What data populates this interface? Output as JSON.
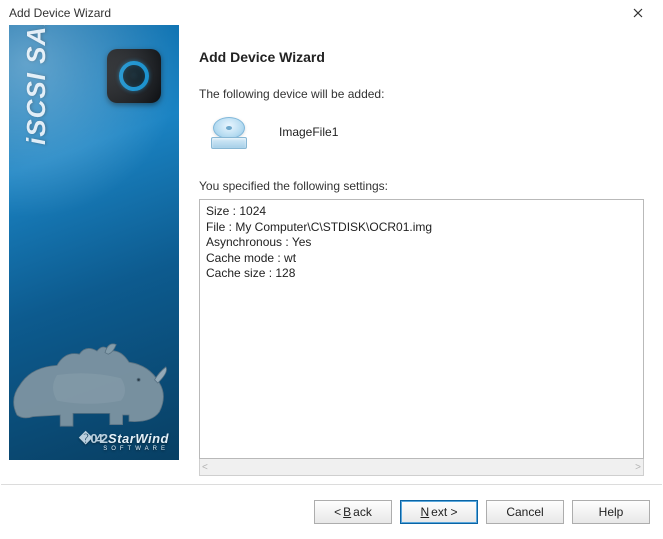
{
  "window": {
    "title": "Add Device Wizard"
  },
  "sidebar": {
    "vertical_label": "iSCSI SAN",
    "logo_text": "StarWind",
    "logo_sub": "SOFTWARE"
  },
  "main": {
    "heading": "Add Device Wizard",
    "intro": "The following device will be added:",
    "device_name": "ImageFile1",
    "settings_label": "You specified the following settings:",
    "settings": {
      "Size": "1024",
      "File": "My Computer\\C\\STDISK\\OCR01.img",
      "Asynchronous": "Yes",
      "Cache mode": "wt",
      "Cache size": "128"
    },
    "settings_text": "Size : 1024\nFile : My Computer\\C\\STDISK\\OCR01.img\nAsynchronous : Yes\nCache mode : wt\nCache size : 128"
  },
  "buttons": {
    "back_prefix": "< ",
    "back_mn": "B",
    "back_suffix": "ack",
    "next_mn": "N",
    "next_suffix": "ext >",
    "cancel": "Cancel",
    "help": "Help"
  }
}
